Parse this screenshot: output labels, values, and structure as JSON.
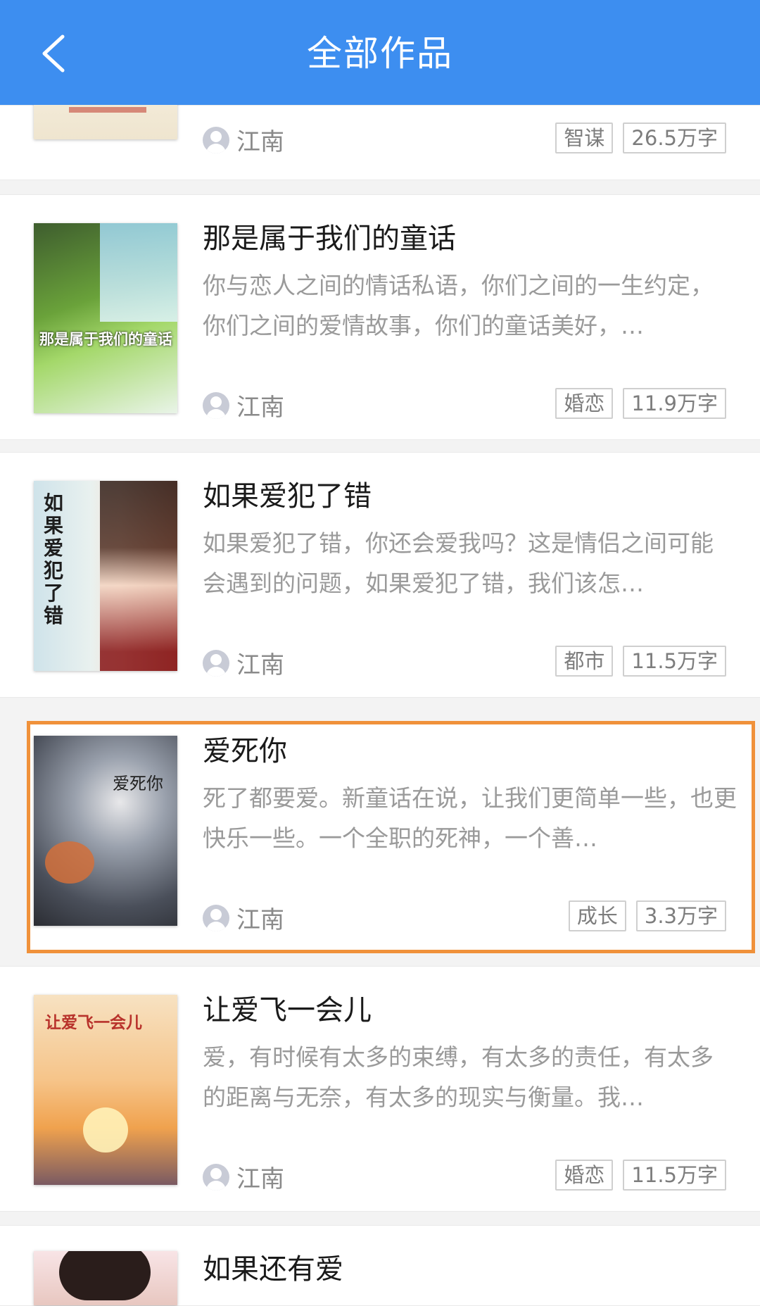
{
  "header": {
    "title": "全部作品"
  },
  "books": [
    {
      "title": "",
      "desc": "",
      "author": "江南",
      "tags": [
        "智谋",
        "26.5万字"
      ]
    },
    {
      "title": "那是属于我们的童话",
      "desc": "你与恋人之间的情话私语，你们之间的一生约定，你们之间的爱情故事，你们的童话美好，…",
      "author": "江南",
      "tags": [
        "婚恋",
        "11.9万字"
      ]
    },
    {
      "title": "如果爱犯了错",
      "desc": "如果爱犯了错，你还会爱我吗？这是情侣之间可能会遇到的问题，如果爱犯了错，我们该怎…",
      "author": "江南",
      "tags": [
        "都市",
        "11.5万字"
      ]
    },
    {
      "title": "爱死你",
      "desc": "死了都要爱。新童话在说，让我们更简单一些，也更快乐一些。一个全职的死神，一个善…",
      "author": "江南",
      "tags": [
        "成长",
        "3.3万字"
      ]
    },
    {
      "title": "让爱飞一会儿",
      "desc": "爱，有时候有太多的束缚，有太多的责任，有太多的距离与无奈，有太多的现实与衡量。我…",
      "author": "江南",
      "tags": [
        "婚恋",
        "11.5万字"
      ]
    },
    {
      "title": "如果还有爱",
      "desc": "",
      "author": "",
      "tags": []
    }
  ],
  "covers": {
    "1": "那是属于我们的童话",
    "2": "如果爱犯了错",
    "3": "爱死你",
    "4": "让爱飞一会儿"
  },
  "colors": {
    "header": "#3d8ef0",
    "selection": "#f0913a"
  }
}
